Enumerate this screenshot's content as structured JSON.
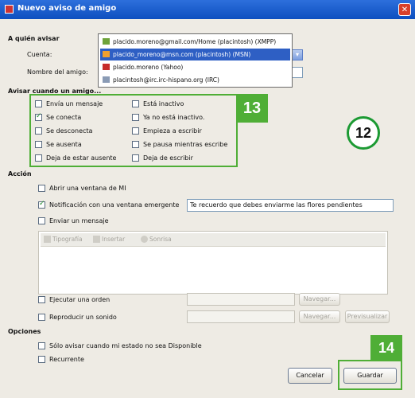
{
  "window": {
    "title": "Nuevo aviso de amigo",
    "close_glyph": "✕"
  },
  "account_section": {
    "heading": "A quién avisar",
    "account_label": "Cuenta:",
    "friend_label": "Nombre del amigo:",
    "dropdown_items": [
      {
        "label": "placido.moreno@gmail.com/Home (placintosh) (XMPP)",
        "icon": "xmpp-icon",
        "selected": false
      },
      {
        "label": "placido_moreno@msn.com (placintosh) (MSN)",
        "icon": "msn-icon",
        "selected": true
      },
      {
        "label": "placido.moreno (Yahoo)",
        "icon": "yahoo-icon",
        "selected": false
      },
      {
        "label": "placintosh@irc.irc-hispano.org (IRC)",
        "icon": "irc-icon",
        "selected": false
      }
    ]
  },
  "notify_section": {
    "heading": "Avisar cuando un amigo...",
    "options_left": [
      {
        "label": "Envía un mensaje",
        "checked": false
      },
      {
        "label": "Se conecta",
        "checked": true
      },
      {
        "label": "Se desconecta",
        "checked": false
      },
      {
        "label": "Se ausenta",
        "checked": false
      },
      {
        "label": "Deja de estar ausente",
        "checked": false
      }
    ],
    "options_right": [
      {
        "label": "Está inactivo",
        "checked": false
      },
      {
        "label": "Ya no está inactivo.",
        "checked": false
      },
      {
        "label": "Empieza a escribir",
        "checked": false
      },
      {
        "label": "Se pausa mientras escribe",
        "checked": false
      },
      {
        "label": "Deja de escribir",
        "checked": false
      }
    ]
  },
  "action_section": {
    "heading": "Acción",
    "open_im": {
      "label": "Abrir una ventana de MI",
      "checked": false
    },
    "popup": {
      "label": "Notificación con una ventana emergente",
      "checked": true,
      "value": "Te recuerdo que debes enviarme las flores pendientes"
    },
    "send_message": {
      "label": "Enviar un mensaje",
      "checked": false
    },
    "toolbar": {
      "font": "Tipografía",
      "insert": "Insertar",
      "smiley": "Sonrisa"
    },
    "run_command": {
      "label": "Ejecutar una orden",
      "checked": false,
      "browse": "Navegar..."
    },
    "play_sound": {
      "label": "Reproducir un sonido",
      "checked": false,
      "browse": "Navegar...",
      "preview": "Previsualizar"
    }
  },
  "options_section": {
    "heading": "Opciones",
    "only_when_away": {
      "label": "Sólo avisar cuando mi estado no sea Disponible",
      "checked": false
    },
    "recurrent": {
      "label": "Recurrente",
      "checked": false
    }
  },
  "buttons": {
    "cancel": "Cancelar",
    "save": "Guardar"
  },
  "callouts": {
    "c12": "12",
    "c13": "13",
    "c14": "14"
  },
  "colors": {
    "callout_green": "#4fae36",
    "title_blue": "#0d4fbf",
    "selection_blue": "#2e5fc4"
  }
}
